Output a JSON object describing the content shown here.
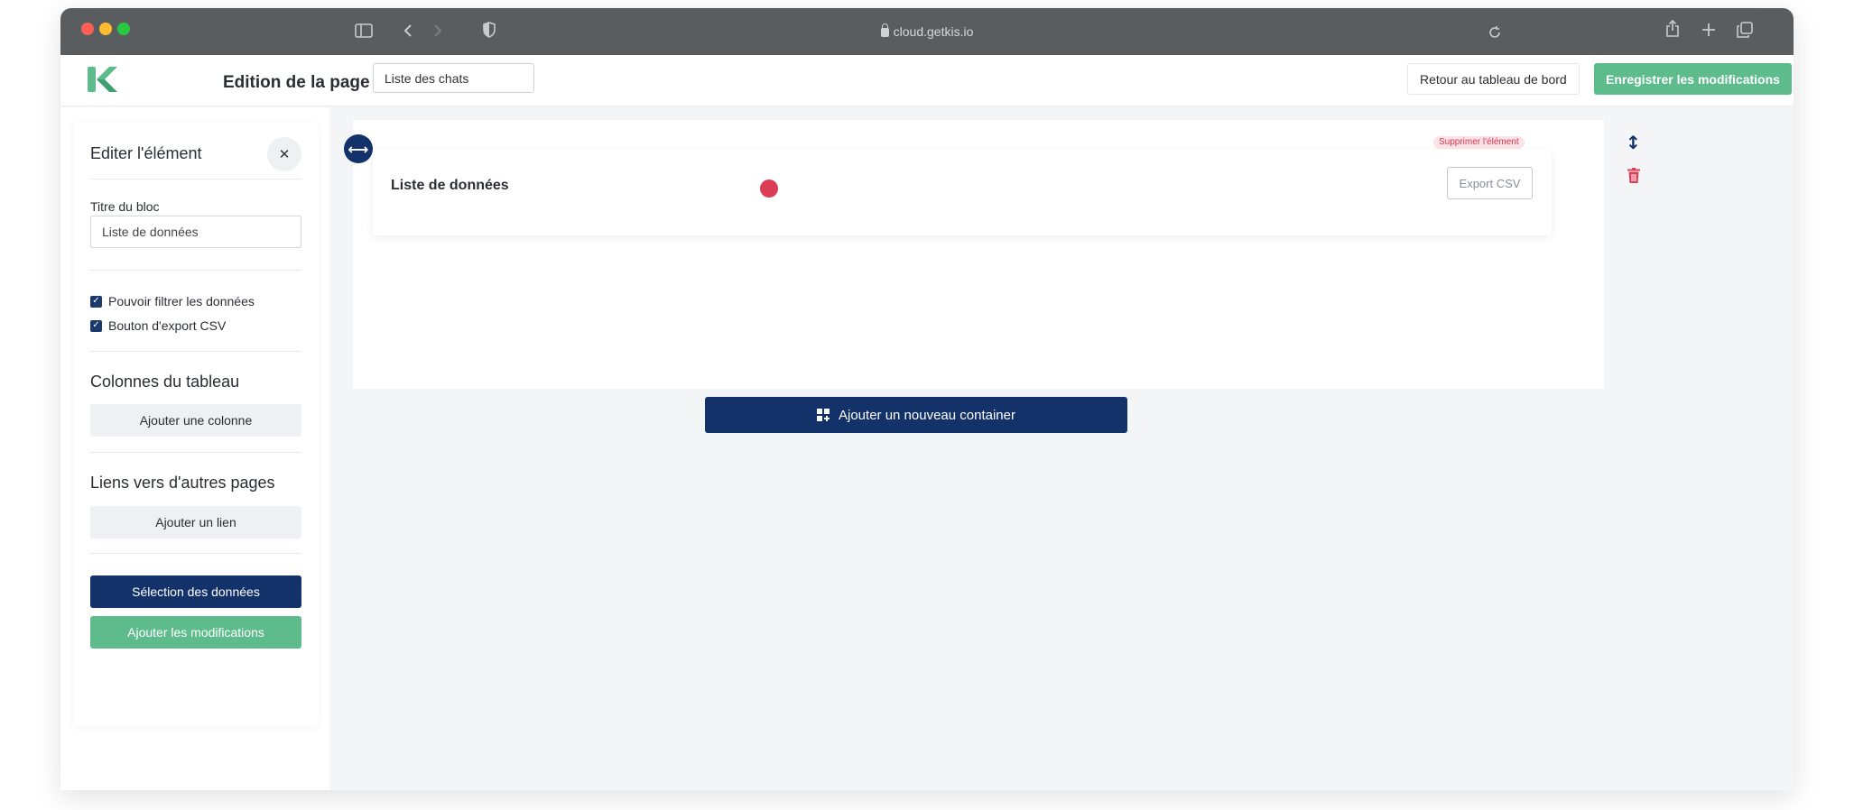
{
  "browser": {
    "url": "cloud.getkis.io"
  },
  "header": {
    "page_label": "Edition de la page :",
    "page_name": "Liste des chats",
    "back_button": "Retour au tableau de bord",
    "save_button": "Enregistrer les modifications"
  },
  "edit_panel": {
    "title": "Editer l'élément",
    "close_symbol": "✕",
    "block_title_label": "Titre du bloc",
    "block_title_value": "Liste de données",
    "checkboxes": [
      {
        "label": "Pouvoir filtrer les données",
        "checked": true
      },
      {
        "label": "Bouton d'export CSV",
        "checked": true
      }
    ],
    "columns_title": "Colonnes du tableau",
    "add_column_button": "Ajouter une colonne",
    "links_title": "Liens vers d'autres pages",
    "add_link_button": "Ajouter un lien",
    "data_selection_button": "Sélection des données",
    "apply_button": "Ajouter les modifications"
  },
  "canvas": {
    "card_title": "Liste de données",
    "export_button": "Export CSV",
    "delete_element": "Supprimer l'élément",
    "add_container_button": "Ajouter un nouveau container"
  },
  "colors": {
    "navy": "#13326a",
    "green": "#5dbb8c",
    "red": "#dc3d56"
  },
  "icons": [
    "sidebar-toggle-icon",
    "back-arrow-icon",
    "forward-arrow-icon",
    "shield-icon",
    "lock-icon",
    "reload-icon",
    "share-icon",
    "plus-icon",
    "tabs-icon",
    "logo-icon",
    "close-icon",
    "checkbox-icon",
    "move-horizontal-icon",
    "move-vertical-icon",
    "trash-icon",
    "grid-add-icon"
  ]
}
